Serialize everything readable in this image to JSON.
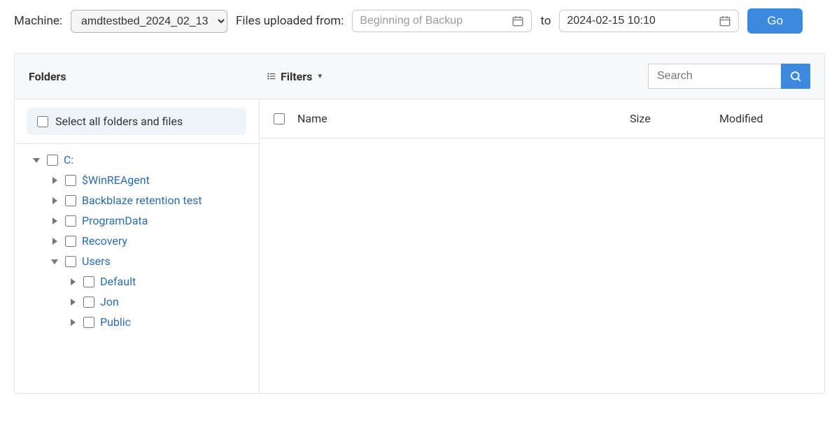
{
  "topBar": {
    "machineLabel": "Machine:",
    "machineValue": "amdtestbed_2024_02_13",
    "uploadedFromLabel": "Files uploaded from:",
    "fromPlaceholder": "Beginning of Backup",
    "fromValue": "",
    "toLabel": "to",
    "toValue": "2024-02-15 10:10",
    "goLabel": "Go"
  },
  "panel": {
    "foldersTitle": "Folders",
    "filtersLabel": "Filters",
    "searchPlaceholder": "Search",
    "selectAllLabel": "Select all folders and files",
    "columns": {
      "name": "Name",
      "size": "Size",
      "modified": "Modified"
    }
  },
  "tree": {
    "root": {
      "label": "C:",
      "expanded": true
    },
    "children": [
      {
        "label": "$WinREAgent",
        "expanded": false
      },
      {
        "label": "Backblaze retention test",
        "expanded": false
      },
      {
        "label": "ProgramData",
        "expanded": false
      },
      {
        "label": "Recovery",
        "expanded": false
      },
      {
        "label": "Users",
        "expanded": true,
        "children": [
          {
            "label": "Default",
            "expanded": false
          },
          {
            "label": "Jon",
            "expanded": false
          },
          {
            "label": "Public",
            "expanded": false
          }
        ]
      }
    ]
  }
}
